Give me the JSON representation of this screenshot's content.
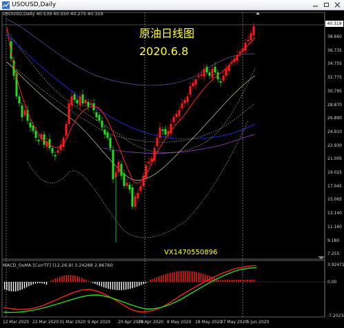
{
  "window": {
    "title": "USOUSD,Daily"
  },
  "chart": {
    "symbol_info": "USOUSD,Daily  40.539 40.550 40.275 40.319",
    "overlay_title": "原油日线图",
    "overlay_date": "2020.6.8",
    "watermark": "VX1470550896",
    "current_price": "40.319",
    "price_axis": [
      "38.660",
      "36.735",
      "34.755",
      "32.775",
      "30.795",
      "28.870",
      "26.890",
      "24.910",
      "22.930",
      "21.005",
      "19.025",
      "17.045",
      "15.065",
      "13.140",
      "11.160",
      "9.180",
      "7.255"
    ],
    "date_axis": [
      "12 Mar 2020",
      "22 Mar 2020",
      "31 Mar 2020",
      "9 Apr 2020",
      "20 Apr 2020",
      "29 Apr 2020",
      "8 May 2020",
      "18 May 2020",
      "27 May 2020",
      "5 Jun 2020"
    ],
    "colors": {
      "bull": "#ff1a1a",
      "bear": "#22dd22",
      "macd_hist_pos": "#ff2020",
      "macd_hist_neg": "#ffffff",
      "signal": "#22dd22",
      "macd": "#ff2020",
      "overlay_text": "#ffff33"
    }
  },
  "macd": {
    "label": "MACD_OsMA [CurrTF] (12,26,9) 3.24288 2.86760",
    "axis": [
      "3.92471",
      "0.00",
      "-7.20234"
    ]
  }
}
